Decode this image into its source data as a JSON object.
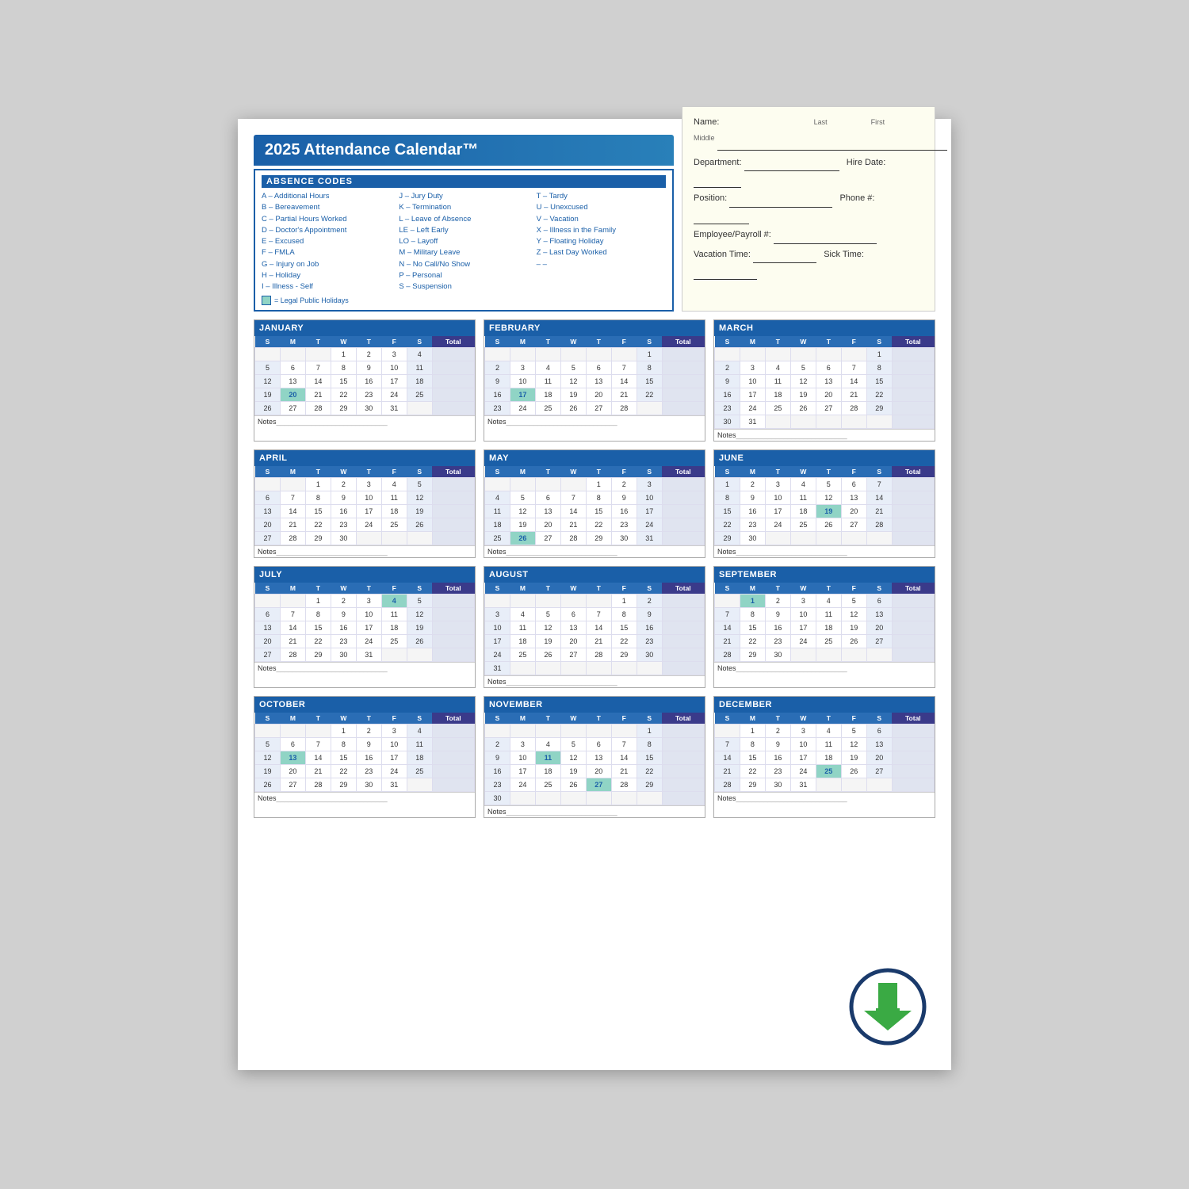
{
  "title": "2025 Attendance Calendar™",
  "infoSection": {
    "name_label": "Name:",
    "last_label": "Last",
    "first_label": "First",
    "middle_label": "Middle",
    "dept_label": "Department:",
    "hire_label": "Hire Date:",
    "position_label": "Position:",
    "phone_label": "Phone #:",
    "payroll_label": "Employee/Payroll #:",
    "vacation_label": "Vacation Time:",
    "sick_label": "Sick Time:"
  },
  "absenceSection": {
    "header": "ABSENCE CODES",
    "col1": [
      "A – Additional Hours",
      "B – Bereavement",
      "C – Partial Hours Worked",
      "D – Doctor's Appointment",
      "E – Excused",
      "F – FMLA",
      "G – Injury on Job",
      "H – Holiday",
      "I – Illness - Self"
    ],
    "col2": [
      "J – Jury Duty",
      "K – Termination",
      "L – Leave of Absence",
      "LE – Left Early",
      "LO – Layoff",
      "M – Military Leave",
      "N – No Call/No Show",
      "P – Personal",
      "S – Suspension"
    ],
    "col3": [
      "T – Tardy",
      "U – Unexcused",
      "V – Vacation",
      "X – Illness in the Family",
      "Y – Floating Holiday",
      "Z – Last Day Worked",
      "– –"
    ],
    "legal_note": "= Legal Public Holidays"
  },
  "months": [
    {
      "name": "JANUARY",
      "days": [
        [
          "",
          "",
          "",
          "1",
          "2",
          "3",
          "4"
        ],
        [
          "5",
          "6",
          "7",
          "8",
          "9",
          "10",
          "11"
        ],
        [
          "12",
          "13",
          "14",
          "15",
          "16",
          "17",
          "18"
        ],
        [
          "19",
          "20*",
          "21",
          "22",
          "23",
          "24",
          "25"
        ],
        [
          "26",
          "27",
          "28",
          "29",
          "30",
          "31",
          ""
        ]
      ],
      "holidays": [
        "1"
      ],
      "highlighted": [
        "20"
      ]
    },
    {
      "name": "FEBRUARY",
      "days": [
        [
          "",
          "",
          "",
          "",
          "",
          "",
          "1"
        ],
        [
          "2",
          "3",
          "4",
          "5",
          "6",
          "7",
          "8"
        ],
        [
          "9",
          "10",
          "11",
          "12",
          "13",
          "14",
          "15"
        ],
        [
          "16",
          "17*",
          "18",
          "19",
          "20",
          "21",
          "22"
        ],
        [
          "23",
          "24",
          "25",
          "26",
          "27",
          "28",
          ""
        ]
      ],
      "holidays": [],
      "highlighted": [
        "17"
      ]
    },
    {
      "name": "MARCH",
      "days": [
        [
          "",
          "",
          "",
          "",
          "",
          "",
          "1"
        ],
        [
          "2",
          "3",
          "4",
          "5",
          "6",
          "7",
          "8"
        ],
        [
          "9",
          "10",
          "11",
          "12",
          "13",
          "14",
          "15"
        ],
        [
          "16",
          "17",
          "18",
          "19",
          "20",
          "21",
          "22"
        ],
        [
          "23",
          "24",
          "25",
          "26",
          "27",
          "28",
          "29"
        ],
        [
          "30",
          "31",
          "",
          "",
          "",
          "",
          ""
        ]
      ],
      "holidays": [],
      "highlighted": []
    },
    {
      "name": "APRIL",
      "days": [
        [
          "",
          "",
          "1",
          "2",
          "3",
          "4",
          "5"
        ],
        [
          "6",
          "7",
          "8",
          "9",
          "10",
          "11",
          "12"
        ],
        [
          "13",
          "14",
          "15",
          "16",
          "17",
          "18",
          "19"
        ],
        [
          "20",
          "21",
          "22",
          "23",
          "24",
          "25",
          "26"
        ],
        [
          "27",
          "28",
          "29",
          "30",
          "",
          "",
          ""
        ]
      ],
      "holidays": [],
      "highlighted": []
    },
    {
      "name": "MAY",
      "days": [
        [
          "",
          "",
          "",
          "",
          "1",
          "2",
          "3"
        ],
        [
          "4",
          "5",
          "6",
          "7",
          "8",
          "9",
          "10"
        ],
        [
          "11",
          "12",
          "13",
          "14",
          "15",
          "16",
          "17"
        ],
        [
          "18",
          "19",
          "20",
          "21",
          "22",
          "23",
          "24"
        ],
        [
          "25",
          "26*",
          "27",
          "28",
          "29",
          "30",
          "31"
        ]
      ],
      "holidays": [],
      "highlighted": [
        "26"
      ]
    },
    {
      "name": "JUNE",
      "days": [
        [
          "1",
          "2",
          "3",
          "4",
          "5",
          "6",
          "7"
        ],
        [
          "8",
          "9",
          "10",
          "11",
          "12",
          "13",
          "14"
        ],
        [
          "15",
          "16",
          "17",
          "18",
          "19*",
          "20",
          "21"
        ],
        [
          "22",
          "23",
          "24",
          "25",
          "26",
          "27",
          "28"
        ],
        [
          "29",
          "30",
          "",
          "",
          "",
          "",
          ""
        ]
      ],
      "holidays": [],
      "highlighted": [
        "19"
      ]
    },
    {
      "name": "JULY",
      "days": [
        [
          "",
          "",
          "1",
          "2",
          "3",
          "4*",
          "5"
        ],
        [
          "6",
          "7",
          "8",
          "9",
          "10",
          "11",
          "12"
        ],
        [
          "13",
          "14",
          "15",
          "16",
          "17",
          "18",
          "19"
        ],
        [
          "20",
          "21",
          "22",
          "23",
          "24",
          "25",
          "26"
        ],
        [
          "27",
          "28",
          "29",
          "30",
          "31",
          "",
          ""
        ]
      ],
      "holidays": [
        "4"
      ],
      "highlighted": [
        "4"
      ]
    },
    {
      "name": "AUGUST",
      "days": [
        [
          "",
          "",
          "",
          "",
          "",
          "1",
          "2"
        ],
        [
          "3",
          "4",
          "5",
          "6",
          "7",
          "8",
          "9"
        ],
        [
          "10",
          "11",
          "12",
          "13",
          "14",
          "15",
          "16"
        ],
        [
          "17",
          "18",
          "19",
          "20",
          "21",
          "22",
          "23"
        ],
        [
          "24",
          "25",
          "26",
          "27",
          "28",
          "29",
          "30"
        ],
        [
          "31",
          "",
          "",
          "",
          "",
          "",
          ""
        ]
      ],
      "holidays": [],
      "highlighted": []
    },
    {
      "name": "SEPTEMBER",
      "days": [
        [
          "",
          "1*",
          "2",
          "3",
          "4",
          "5",
          "6"
        ],
        [
          "7",
          "8",
          "9",
          "10",
          "11",
          "12",
          "13"
        ],
        [
          "14",
          "15",
          "16",
          "17",
          "18",
          "19",
          "20"
        ],
        [
          "21",
          "22",
          "23",
          "24",
          "25",
          "26",
          "27"
        ],
        [
          "28",
          "29",
          "30",
          "",
          "",
          "",
          ""
        ]
      ],
      "holidays": [
        "1"
      ],
      "highlighted": [
        "1"
      ]
    },
    {
      "name": "OCTOBER",
      "days": [
        [
          "",
          "",
          "",
          "1",
          "2",
          "3",
          "4"
        ],
        [
          "5",
          "6",
          "7",
          "8",
          "9",
          "10",
          "11"
        ],
        [
          "12",
          "13*",
          "14",
          "15",
          "16",
          "17",
          "18"
        ],
        [
          "19",
          "20",
          "21",
          "22",
          "23",
          "24",
          "25"
        ],
        [
          "26",
          "27",
          "28",
          "29",
          "30",
          "31",
          ""
        ]
      ],
      "holidays": [],
      "highlighted": [
        "13"
      ]
    },
    {
      "name": "NOVEMBER",
      "days": [
        [
          "",
          "",
          "",
          "",
          "",
          "",
          "1"
        ],
        [
          "2",
          "3",
          "4",
          "5",
          "6",
          "7",
          "8"
        ],
        [
          "9",
          "10",
          "11*",
          "12",
          "13",
          "14",
          "15"
        ],
        [
          "16",
          "17",
          "18",
          "19",
          "20",
          "21",
          "22"
        ],
        [
          "23",
          "24",
          "25",
          "26",
          "27*",
          "28",
          "29"
        ],
        [
          "30",
          "",
          "",
          "",
          "",
          "",
          ""
        ]
      ],
      "holidays": [
        "11",
        "27"
      ],
      "highlighted": [
        "11",
        "27"
      ]
    },
    {
      "name": "DECEMBER",
      "days": [
        [
          "",
          "1",
          "2",
          "3",
          "4",
          "5",
          "6"
        ],
        [
          "7",
          "8",
          "9",
          "10",
          "11",
          "12",
          "13"
        ],
        [
          "14",
          "15",
          "16",
          "17",
          "18",
          "19",
          "20"
        ],
        [
          "21",
          "22",
          "23",
          "24",
          "25*",
          "26",
          "27"
        ],
        [
          "28",
          "29",
          "30",
          "31",
          "",
          "",
          ""
        ]
      ],
      "holidays": [
        "25"
      ],
      "highlighted": [
        "25"
      ]
    }
  ],
  "weekdays": [
    "S",
    "M",
    "T",
    "W",
    "T",
    "F",
    "S",
    "Total"
  ]
}
